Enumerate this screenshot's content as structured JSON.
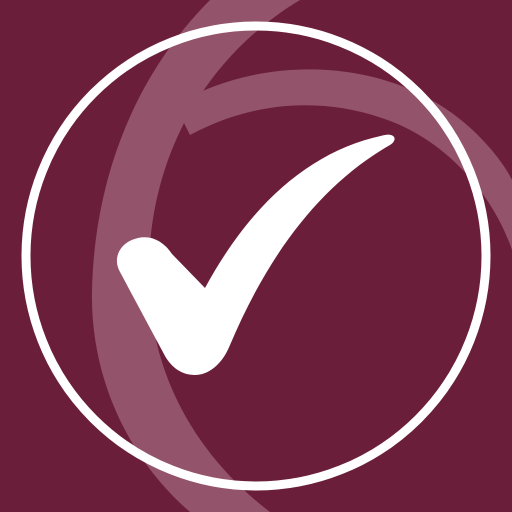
{
  "icon": {
    "name": "checkmark-app-icon",
    "symbol": "check-icon",
    "colors": {
      "background": "#6b1e39",
      "swoosh": "#93536a",
      "foreground": "#ffffff"
    }
  }
}
